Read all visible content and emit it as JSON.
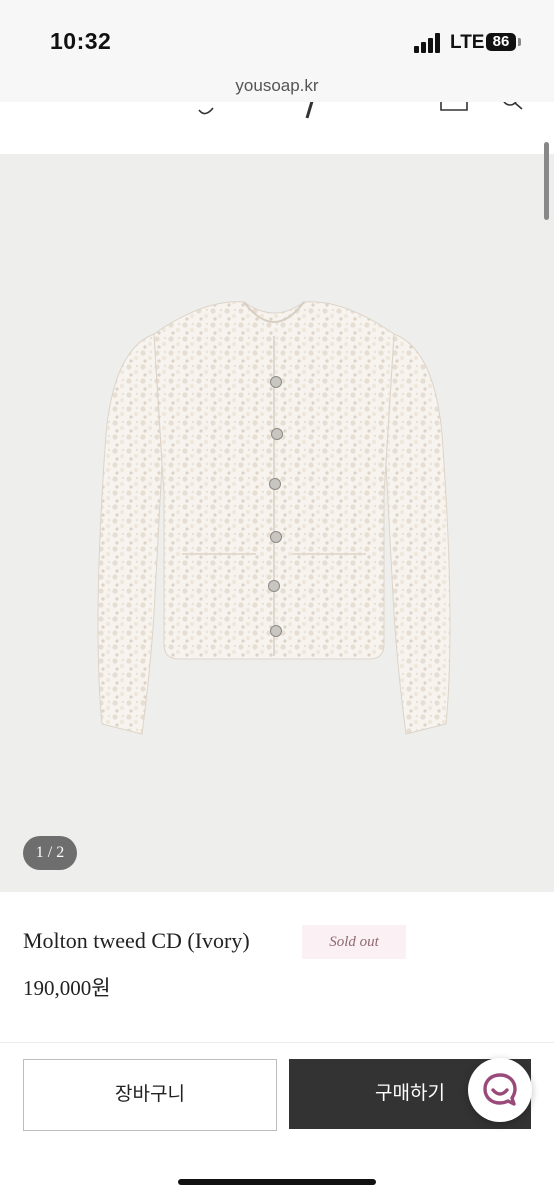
{
  "status_bar": {
    "time": "10:32",
    "network": "LTE",
    "battery": "86"
  },
  "browser": {
    "url": "yousoap.kr"
  },
  "header": {
    "icons": [
      "bag-icon",
      "search-icon"
    ]
  },
  "gallery": {
    "pager": "1 / 2",
    "image": "ivory-tweed-cardigan"
  },
  "product": {
    "name": "Molton tweed CD (Ivory)",
    "badge": "Sold out",
    "price": "190,000원"
  },
  "actions": {
    "cart_label": "장바구니",
    "buy_label": "구매하기",
    "chat_icon": "chat-icon"
  },
  "colors": {
    "accent": "#333333",
    "badge_bg": "#fbf1f4",
    "chat": "#9a4a7a",
    "gallery_bg": "#eeeeec"
  }
}
